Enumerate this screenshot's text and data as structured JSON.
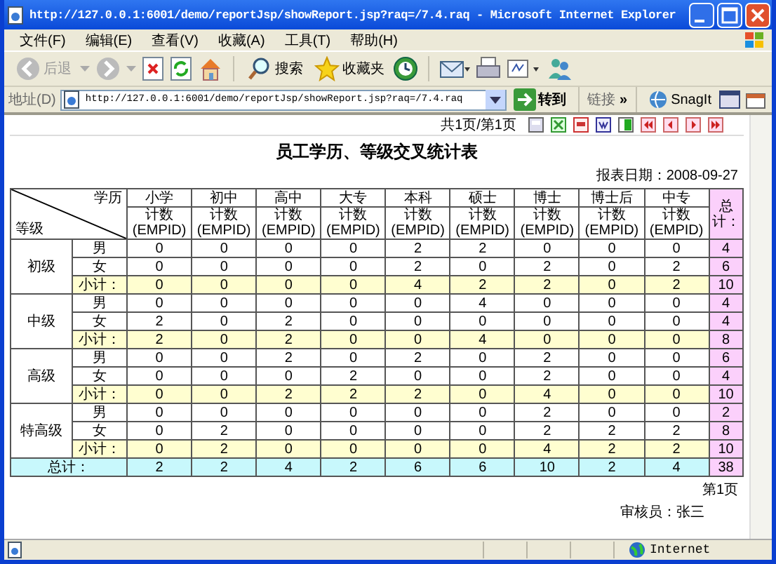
{
  "window": {
    "title": "http://127.0.0.1:6001/demo/reportJsp/showReport.jsp?raq=/7.4.raq - Microsoft Internet Explorer"
  },
  "menu": [
    "文件(F)",
    "编辑(E)",
    "查看(V)",
    "收藏(A)",
    "工具(T)",
    "帮助(H)"
  ],
  "toolbar": {
    "back": "后退",
    "search": "搜索",
    "favorites": "收藏夹"
  },
  "address_bar": {
    "label": "地址(D)",
    "value": "http://127.0.0.1:6001/demo/reportJsp/showReport.jsp?raq=/7.4.raq",
    "go": "转到",
    "links": "链接",
    "chevron": "»",
    "snagit": "SnagIt"
  },
  "report_toolbar": {
    "page_info": "共1页/第1页"
  },
  "report": {
    "title": "员工学历、等级交叉统计表",
    "date": "报表日期：2008-09-27",
    "corner_top": "学历",
    "corner_bottom": "等级",
    "columns": [
      {
        "label": "小学",
        "sub": "计数(EMPID)"
      },
      {
        "label": "初中",
        "sub": "计数(EMPID)"
      },
      {
        "label": "高中",
        "sub": "计数(EMPID)"
      },
      {
        "label": "大专",
        "sub": "计数(EMPID)"
      },
      {
        "label": "本科",
        "sub": "计数(EMPID)"
      },
      {
        "label": "硕士",
        "sub": "计数(EMPID)"
      },
      {
        "label": "博士",
        "sub": "计数(EMPID)"
      },
      {
        "label": "博士后",
        "sub": "计数(EMPID)"
      },
      {
        "label": "中专",
        "sub": "计数(EMPID)"
      }
    ],
    "total_label": "总计：",
    "groups": [
      {
        "label": "初级",
        "rows": [
          {
            "kind": "item",
            "label": "男",
            "values": [
              "0",
              "0",
              "0",
              "0",
              "2",
              "2",
              "0",
              "0",
              "0"
            ],
            "total": "4"
          },
          {
            "kind": "item",
            "label": "女",
            "values": [
              "0",
              "0",
              "0",
              "0",
              "2",
              "0",
              "2",
              "0",
              "2"
            ],
            "total": "6"
          },
          {
            "kind": "subtotal",
            "label": "小计：",
            "values": [
              "0",
              "0",
              "0",
              "0",
              "4",
              "2",
              "2",
              "0",
              "2"
            ],
            "total": "10"
          }
        ]
      },
      {
        "label": "中级",
        "rows": [
          {
            "kind": "item",
            "label": "男",
            "values": [
              "0",
              "0",
              "0",
              "0",
              "0",
              "4",
              "0",
              "0",
              "0"
            ],
            "total": "4"
          },
          {
            "kind": "item",
            "label": "女",
            "values": [
              "2",
              "0",
              "2",
              "0",
              "0",
              "0",
              "0",
              "0",
              "0"
            ],
            "total": "4"
          },
          {
            "kind": "subtotal",
            "label": "小计：",
            "values": [
              "2",
              "0",
              "2",
              "0",
              "0",
              "4",
              "0",
              "0",
              "0"
            ],
            "total": "8"
          }
        ]
      },
      {
        "label": "高级",
        "rows": [
          {
            "kind": "item",
            "label": "男",
            "values": [
              "0",
              "0",
              "2",
              "0",
              "2",
              "0",
              "2",
              "0",
              "0"
            ],
            "total": "6"
          },
          {
            "kind": "item",
            "label": "女",
            "values": [
              "0",
              "0",
              "0",
              "2",
              "0",
              "0",
              "2",
              "0",
              "0"
            ],
            "total": "4"
          },
          {
            "kind": "subtotal",
            "label": "小计：",
            "values": [
              "0",
              "0",
              "2",
              "2",
              "2",
              "0",
              "4",
              "0",
              "0"
            ],
            "total": "10"
          }
        ]
      },
      {
        "label": "特高级",
        "rows": [
          {
            "kind": "item",
            "label": "男",
            "values": [
              "0",
              "0",
              "0",
              "0",
              "0",
              "0",
              "2",
              "0",
              "0"
            ],
            "total": "2"
          },
          {
            "kind": "item",
            "label": "女",
            "values": [
              "0",
              "2",
              "0",
              "0",
              "0",
              "0",
              "2",
              "2",
              "2"
            ],
            "total": "8"
          },
          {
            "kind": "subtotal",
            "label": "小计：",
            "values": [
              "0",
              "2",
              "0",
              "0",
              "0",
              "0",
              "4",
              "2",
              "2"
            ],
            "total": "10"
          }
        ]
      }
    ],
    "grand_total": {
      "label": "总计：",
      "values": [
        "2",
        "2",
        "4",
        "2",
        "6",
        "6",
        "10",
        "2",
        "4"
      ],
      "total": "38"
    },
    "page": "第1页",
    "auditor": "审核员：张三"
  },
  "status_bar": {
    "zone": "Internet"
  }
}
